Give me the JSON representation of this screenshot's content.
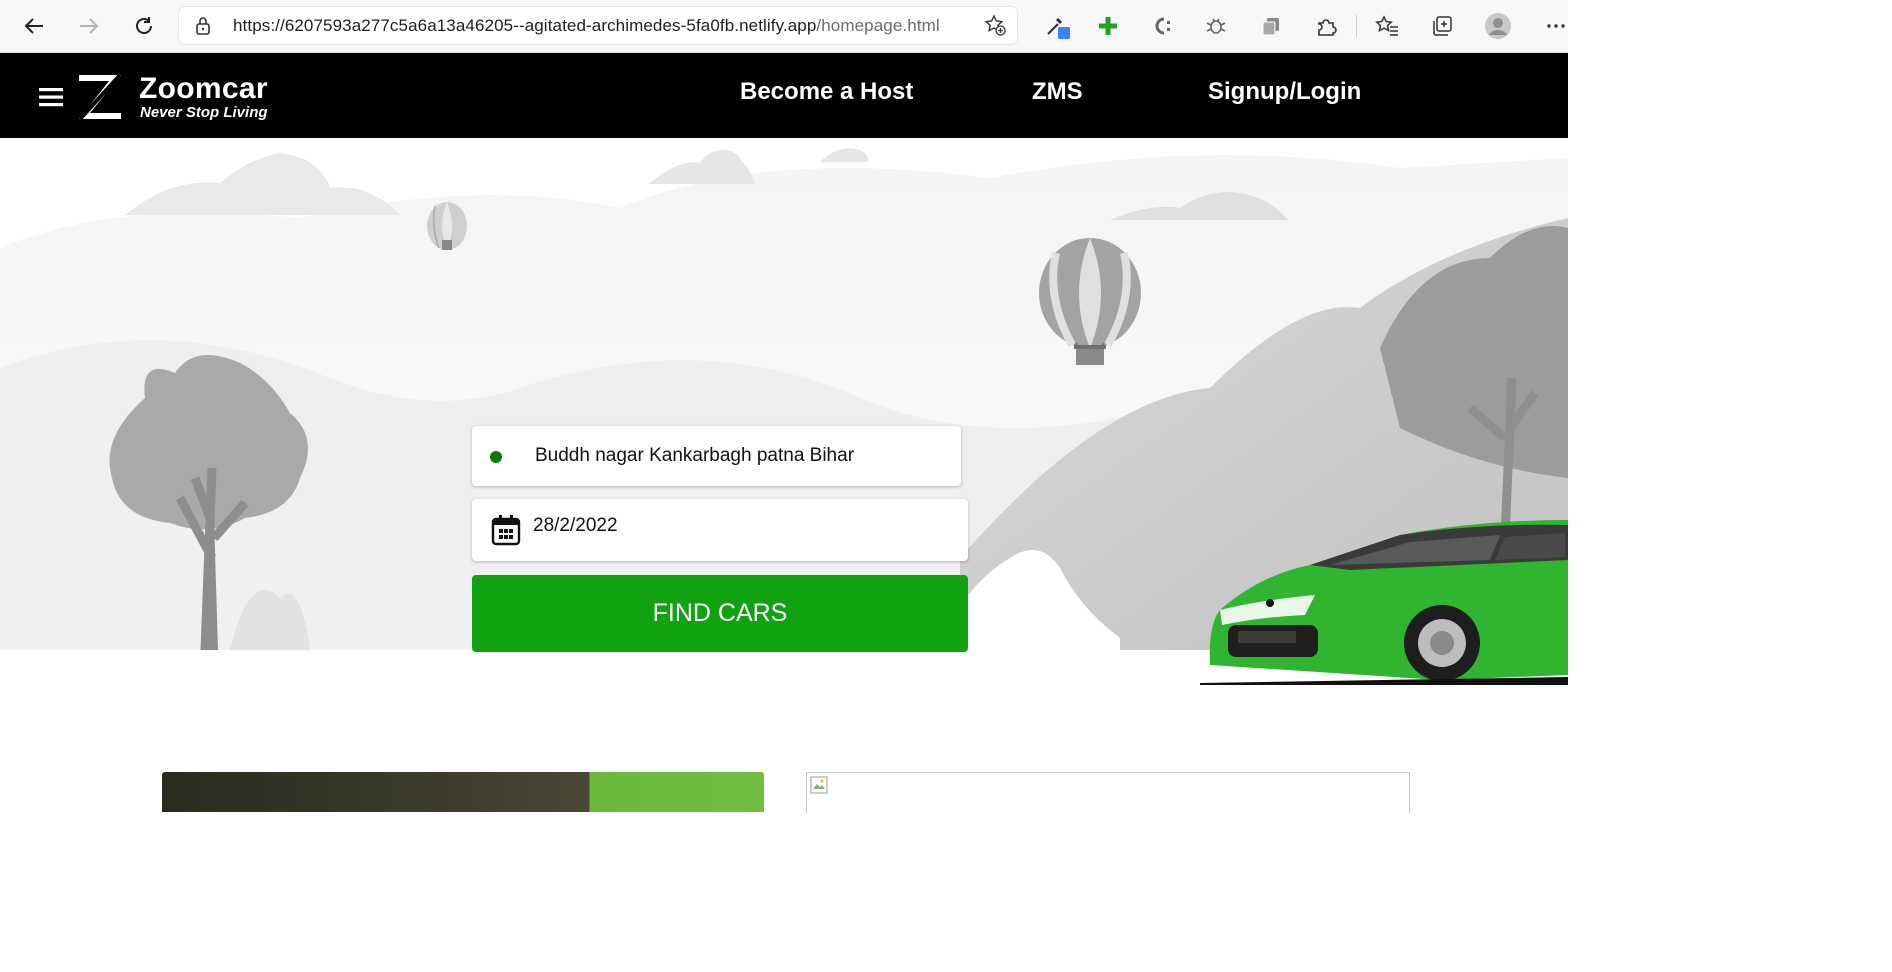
{
  "browser": {
    "url_host": "https://6207593a277c5a6a13a46205--agitated-archimedes-5fa0fb.netlify.app",
    "url_path": "/homepage.html",
    "icons": [
      "back-icon",
      "forward-icon",
      "refresh-icon",
      "lock-icon",
      "favorite-add-icon",
      "eyedropper-icon",
      "plus-icon",
      "extension-c-icon",
      "bug-icon",
      "copy-icon",
      "puzzle-icon",
      "favorites-icon",
      "collections-icon",
      "profile-avatar",
      "more-icon"
    ]
  },
  "header": {
    "brand": "Zoomcar",
    "tagline": "Never Stop Living",
    "nav": [
      "Become a Host",
      "ZMS",
      "Signup/Login"
    ]
  },
  "search": {
    "location": "Buddh nagar Kankarbagh patna Bihar",
    "date": "28/2/2022",
    "button_label": "FIND CARS"
  },
  "colors": {
    "header_bg": "#000000",
    "accent_green": "#10a210",
    "car_green": "#2fb52f",
    "location_dot": "#0b7a0b"
  }
}
